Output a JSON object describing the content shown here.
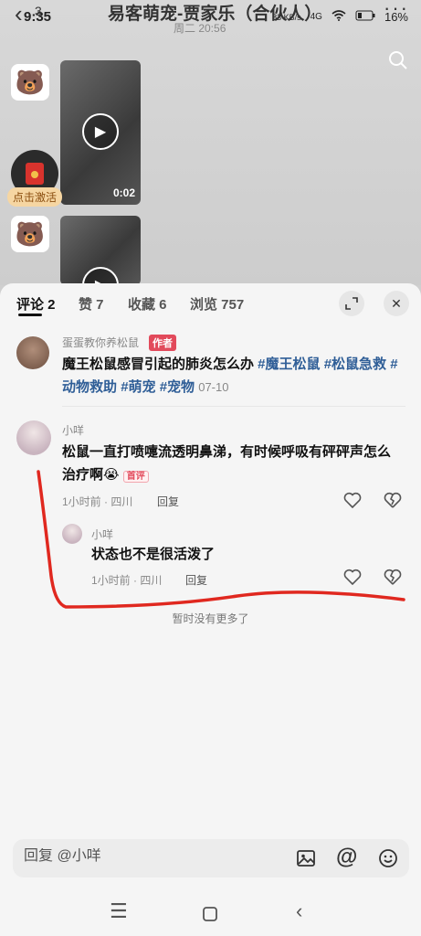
{
  "status_bar": {
    "time": "9:35",
    "net_speed": "83 KB/s",
    "signal": "4G",
    "battery": "16%"
  },
  "header": {
    "back_count": "3",
    "title": "易客萌宠-贾家乐（合伙人）",
    "date_separator": "周二 20:56"
  },
  "chat": {
    "video_duration": "0:02",
    "activate_label": "点击激活"
  },
  "panel": {
    "tabs": [
      {
        "label": "评论 2"
      },
      {
        "label": "赞 7"
      },
      {
        "label": "收藏 6"
      },
      {
        "label": "浏览 757"
      }
    ]
  },
  "post": {
    "author": "蛋蛋教你养松鼠",
    "author_badge": "作者",
    "text": "魔王松鼠感冒引起的肺炎怎么办 ",
    "tags": [
      "#魔王松鼠",
      "#松鼠急救",
      "#动物救助",
      "#萌宠",
      "#宠物"
    ],
    "date": "07-10"
  },
  "comments": [
    {
      "name": "小咩",
      "text": "松鼠一直打喷嚏流透明鼻涕，有时候呼吸有砰砰声怎么治疗啊",
      "emoji": "😭",
      "badge": "首评",
      "meta": "1小时前 · 四川",
      "reply_label": "回复"
    },
    {
      "name": "小咩",
      "text": "状态也不是很活泼了",
      "meta": "1小时前 · 四川",
      "reply_label": "回复"
    }
  ],
  "footer_note": "暂时没有更多了",
  "input": {
    "placeholder": "回复 @小咩"
  },
  "colors": {
    "tag_blue": "#2f5e97",
    "badge_red": "#e24a5b",
    "annotation_red": "#e0281f"
  }
}
